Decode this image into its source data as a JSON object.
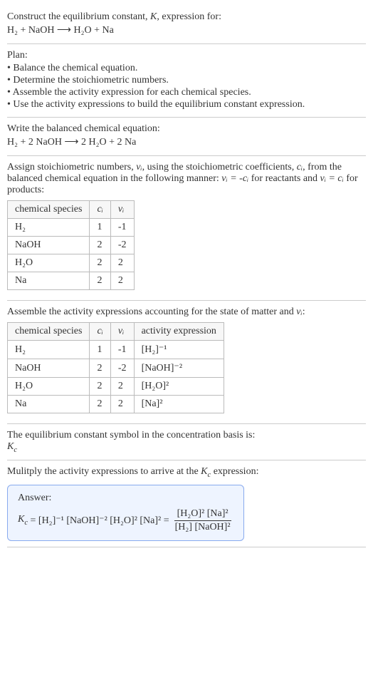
{
  "chart_data": [
    {
      "type": "table",
      "title": "Stoichiometric numbers",
      "columns": [
        "chemical species",
        "c_i",
        "ν_i"
      ],
      "rows": [
        [
          "H₂",
          "1",
          "-1"
        ],
        [
          "NaOH",
          "2",
          "-2"
        ],
        [
          "H₂O",
          "2",
          "2"
        ],
        [
          "Na",
          "2",
          "2"
        ]
      ]
    },
    {
      "type": "table",
      "title": "Activity expressions",
      "columns": [
        "chemical species",
        "c_i",
        "ν_i",
        "activity expression"
      ],
      "rows": [
        [
          "H₂",
          "1",
          "-1",
          "[H₂]⁻¹"
        ],
        [
          "NaOH",
          "2",
          "-2",
          "[NaOH]⁻²"
        ],
        [
          "H₂O",
          "2",
          "2",
          "[H₂O]²"
        ],
        [
          "Na",
          "2",
          "2",
          "[Na]²"
        ]
      ]
    }
  ],
  "intro": {
    "line1_a": "Construct the equilibrium constant, ",
    "line1_k": "K",
    "line1_b": ", expression for:",
    "eq": "H₂ + NaOH ⟶ H₂O + Na"
  },
  "plan": {
    "title": "Plan:",
    "items": [
      "• Balance the chemical equation.",
      "• Determine the stoichiometric numbers.",
      "• Assemble the activity expression for each chemical species.",
      "• Use the activity expressions to build the equilibrium constant expression."
    ]
  },
  "balanced": {
    "text": "Write the balanced chemical equation:",
    "eq": "H₂ + 2 NaOH ⟶ 2 H₂O + 2 Na"
  },
  "stoich": {
    "p1": "Assign stoichiometric numbers, ",
    "nu": "νᵢ",
    "p2": ", using the stoichiometric coefficients, ",
    "ci": "cᵢ",
    "p3": ", from the balanced chemical equation in the following manner: ",
    "eq1": "νᵢ = -cᵢ",
    "p4": " for reactants and ",
    "eq2": "νᵢ = cᵢ",
    "p5": " for products:",
    "h1": "chemical species",
    "h2": "cᵢ",
    "h3": "νᵢ",
    "r": {
      "a1": "H₂",
      "a2": "1",
      "a3": "-1",
      "b1": "NaOH",
      "b2": "2",
      "b3": "-2",
      "c1": "H₂O",
      "c2": "2",
      "c3": "2",
      "d1": "Na",
      "d2": "2",
      "d3": "2"
    }
  },
  "activity": {
    "text_a": "Assemble the activity expressions accounting for the state of matter and ",
    "nu": "νᵢ",
    "text_b": ":",
    "h1": "chemical species",
    "h2": "cᵢ",
    "h3": "νᵢ",
    "h4": "activity expression",
    "r": {
      "a1": "H₂",
      "a2": "1",
      "a3": "-1",
      "a4": "[H₂]⁻¹",
      "b1": "NaOH",
      "b2": "2",
      "b3": "-2",
      "b4": "[NaOH]⁻²",
      "c1": "H₂O",
      "c2": "2",
      "c3": "2",
      "c4": "[H₂O]²",
      "d1": "Na",
      "d2": "2",
      "d3": "2",
      "d4": "[Na]²"
    }
  },
  "symbol": {
    "text": "The equilibrium constant symbol in the concentration basis is:",
    "kc": "K",
    "kc_sub": "c"
  },
  "final": {
    "text_a": "Mulitply the activity expressions to arrive at the ",
    "kc": "K",
    "kc_sub": "c",
    "text_b": " expression:",
    "answer_label": "Answer:",
    "lhs": "Kc = [H₂]⁻¹ [NaOH]⁻² [H₂O]² [Na]² = ",
    "num": "[H₂O]² [Na]²",
    "den": "[H₂] [NaOH]²"
  }
}
